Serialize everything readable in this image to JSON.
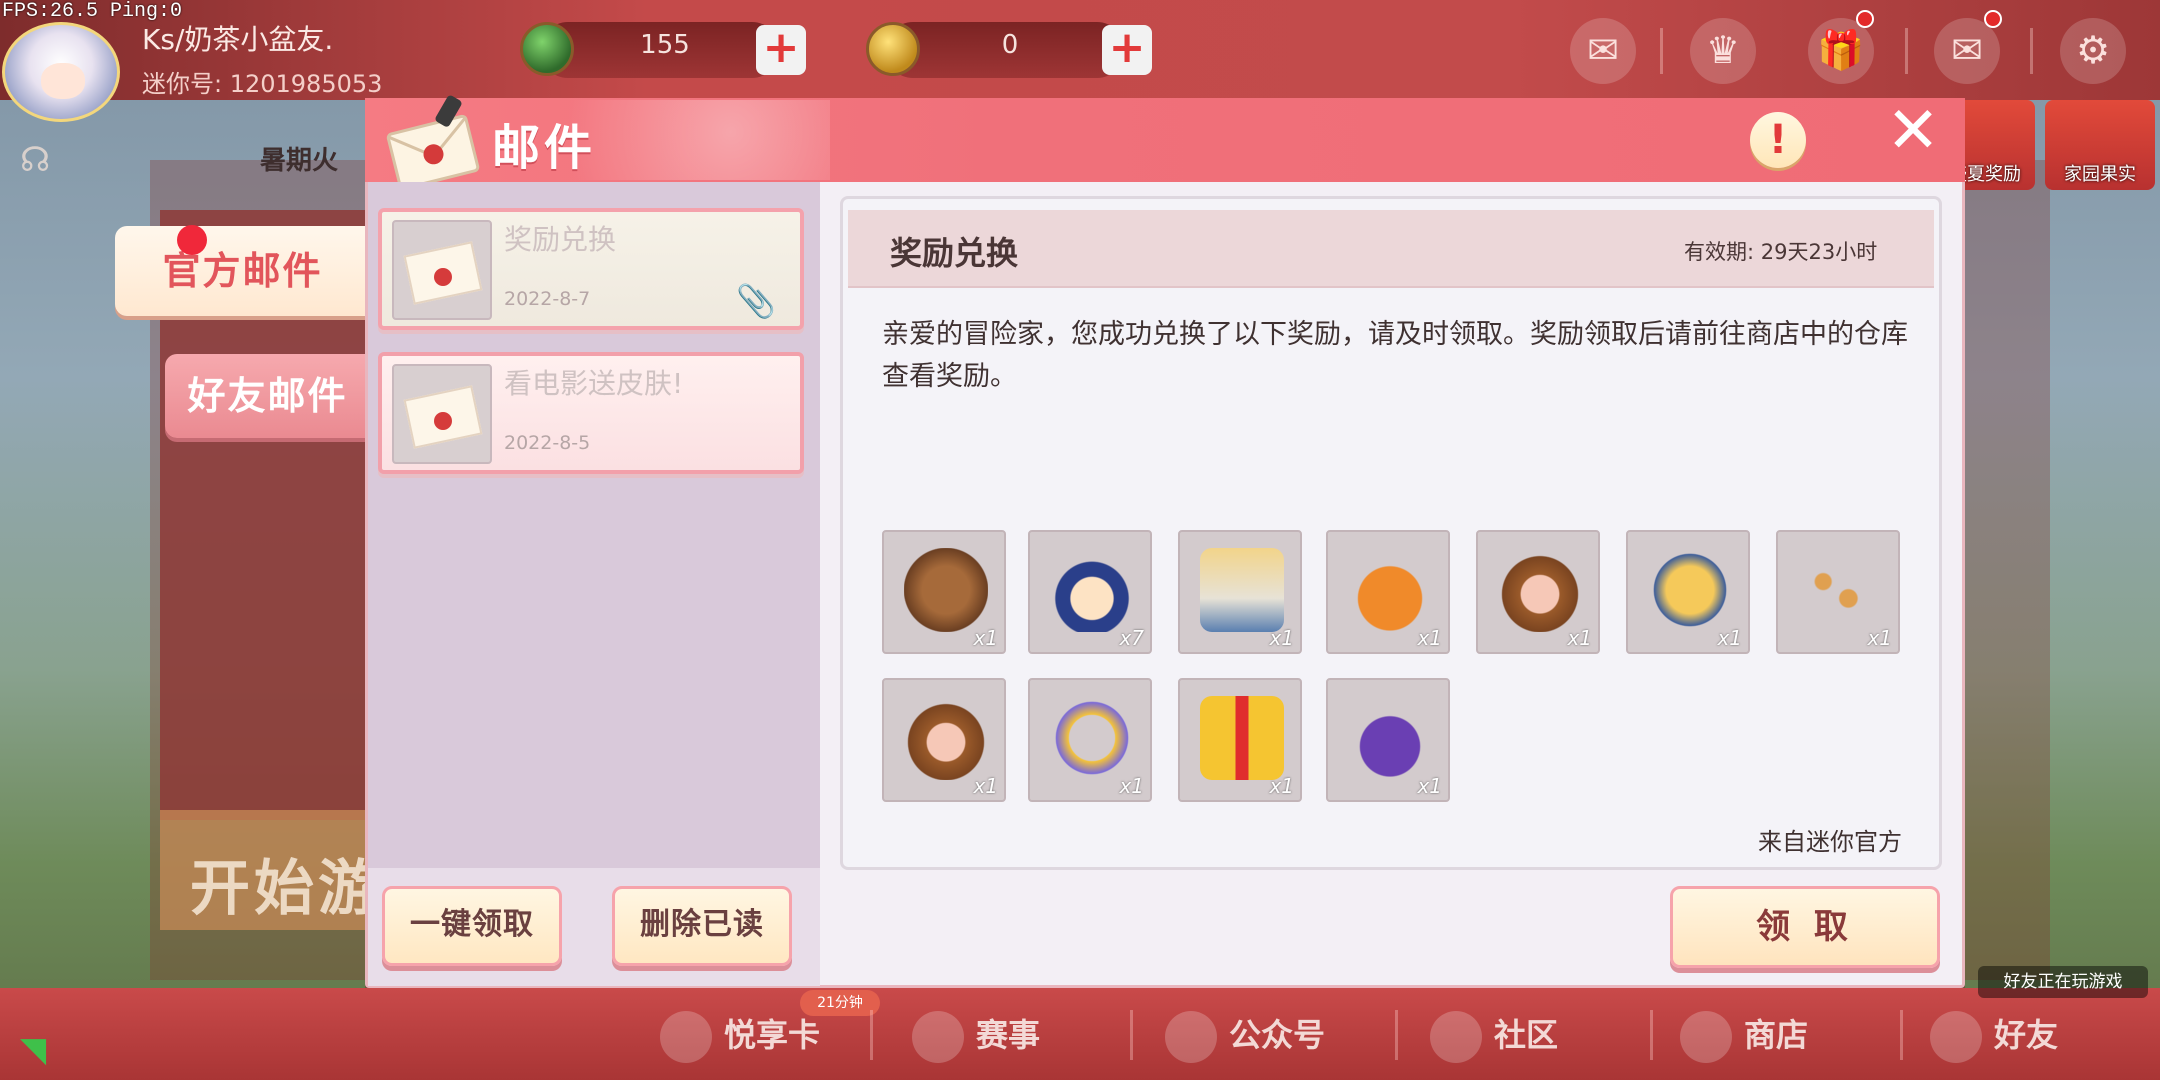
{
  "status": {
    "fps": "FPS:26.5  Ping:0"
  },
  "profile": {
    "nickname": "Ks/奶茶小盆友.",
    "uid": "迷你号: 1201985053"
  },
  "currency": [
    {
      "icon": "green-gem-icon",
      "value": "155"
    },
    {
      "icon": "gold-coin-icon",
      "value": "0"
    }
  ],
  "top_icons": [
    "fox-chat-icon",
    "crown-icon",
    "gift-icon",
    "mail-icon",
    "gear-icon"
  ],
  "activity_label": "暑期火",
  "side_pills": [
    {
      "label": "盛夏奖励"
    },
    {
      "label": "家园果实"
    }
  ],
  "tabs": {
    "official": "官方邮件",
    "friends": "好友邮件"
  },
  "panel": {
    "title": "邮件",
    "info": "!",
    "close": "✕"
  },
  "mail_list": [
    {
      "subject": "奖励兑换",
      "date": "2022-8-7",
      "selected": true,
      "has_attachment": true
    },
    {
      "subject": "看电影送皮肤!",
      "date": "2022-8-5",
      "selected": false,
      "has_attachment": false
    }
  ],
  "list_actions": {
    "claim_all": "一键领取",
    "delete_read": "删除已读"
  },
  "mail_detail": {
    "title": "奖励兑换",
    "expiry": "有效期: 29天23小时",
    "body": "亲爱的冒险家，您成功兑换了以下奖励，请及时领取。奖励领取后请前往商店中的仓库查看奖励。",
    "sender": "来自迷你官方",
    "claim": "领 取"
  },
  "rewards": [
    {
      "icon": "bear-boots-icon",
      "qty": "x1"
    },
    {
      "icon": "wizard-avatar-icon",
      "qty": "x7"
    },
    {
      "icon": "outfit-icon",
      "qty": "x1"
    },
    {
      "icon": "carrot-pet-icon",
      "qty": "x1"
    },
    {
      "icon": "bear-hood-icon",
      "qty": "x1"
    },
    {
      "icon": "bear-gloves-icon",
      "qty": "x1"
    },
    {
      "icon": "sparkle-trail-icon",
      "qty": "x1"
    },
    {
      "icon": "bear-hood-icon",
      "qty": "x1"
    },
    {
      "icon": "avatar-frame-icon",
      "qty": "x1"
    },
    {
      "icon": "gift-box-icon",
      "qty": "x1"
    },
    {
      "icon": "mystery-bag-icon",
      "qty": "x1"
    }
  ],
  "bottom_nav": [
    {
      "label": "悦享卡",
      "icon": "pig-icon"
    },
    {
      "label": "赛事",
      "icon": "trophy-icon"
    },
    {
      "label": "公众号",
      "icon": "star-badge-icon"
    },
    {
      "label": "社区",
      "icon": "community-icon"
    },
    {
      "label": "商店",
      "icon": "cart-icon"
    },
    {
      "label": "好友",
      "icon": "friends-icon"
    }
  ],
  "vip_badge": "21分钟",
  "friends_playing": "好友正在玩游戏",
  "background_text": "开始游",
  "colors": {
    "accent": "#f0707a",
    "header_red": "#c44a4a",
    "alert": "#e32a2a"
  }
}
